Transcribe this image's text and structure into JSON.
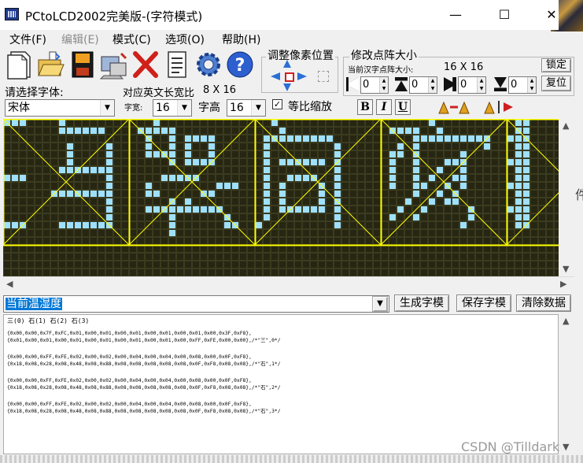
{
  "window": {
    "title": "PCtoLCD2002完美版-(字符模式)",
    "minimize": "—",
    "maximize": "☐",
    "close": "✕"
  },
  "menu": [
    {
      "label": "文件(F)",
      "enabled": true
    },
    {
      "label": "编辑(E)",
      "enabled": false
    },
    {
      "label": "模式(C)",
      "enabled": true
    },
    {
      "label": "选项(O)",
      "enabled": true
    },
    {
      "label": "帮助(H)",
      "enabled": true
    }
  ],
  "toolbar": {
    "icons": [
      "new-file-icon",
      "open-file-icon",
      "save-icon",
      "export-icon",
      "delete-icon",
      "notes-icon",
      "settings-gear-icon",
      "help-icon"
    ]
  },
  "font_panel": {
    "select_font_label": "请选择字体:",
    "font_value": "宋体",
    "ratio_label": "对应英文长宽比",
    "ratio_value": "8 X 16",
    "width_label": "字宽:",
    "width_value": "16",
    "height_label": "字高",
    "height_value": "16",
    "proportional_label": "等比缩放",
    "proportional_checked": true,
    "bold_label": "B",
    "italic_label": "I",
    "underline_label": "U"
  },
  "pixel_adjust": {
    "title": "调整像素位置"
  },
  "matrix_size": {
    "title": "修改点阵大小",
    "current_label": "当前汉字点阵大小:",
    "current_value": "16 X 16",
    "lock_label": "锁定",
    "reset_label": "复位",
    "spins": [
      "0",
      "0",
      "0",
      "0"
    ]
  },
  "grid": {
    "cols": 16,
    "rows": 16,
    "on_color": "#9fe0ff",
    "off_color": "#262613",
    "line_color": "#6a6a3c",
    "border_color": "#ffff00",
    "chars": [
      [
        "1110000100000000",
        "0000000111111000",
        "0000000000000000",
        "0000000010000100",
        "0000000010000100",
        "0000000010000100",
        "0000000111111100",
        "1110000000000100",
        "0000000000000100",
        "0000001111111100",
        "0000000000000100",
        "0000000000000100",
        "0000000000000100",
        "1110000111111100",
        "0000000000000000",
        "0000000000000000"
      ],
      [
        "0001000000000000",
        "0111110000000000",
        "0010010111100000",
        "0010010100100000",
        "0011110100100000",
        "0000010111100000",
        "0000000000000000",
        "0000111110000000",
        "0010000000011100",
        "0011000001100000",
        "0000010100000000",
        "0011111111110000",
        "0000010000001000",
        "0000010000001100",
        "0000010000000000",
        "0000000000000000"
      ],
      [
        "0010000000000000",
        "0001000000000000",
        "0111111111000000",
        "0100000000100000",
        "0100000000100000",
        "0101111110100000",
        "0100000000100000",
        "0100111100100000",
        "0101000010100000",
        "0101000010100000",
        "0101000010100000",
        "0101111110100000",
        "0100000000100000",
        "1000000000100000",
        "0000000000000000",
        "0000000000000000"
      ],
      [
        "0000001000000000",
        "0111100100000000",
        "0000111111111100",
        "0010100000000100",
        "0110100000100000",
        "0100100011100000",
        "0100100100100000",
        "0100101001100000",
        "0100110010100000",
        "0000100101000000",
        "0001001011000000",
        "0010010000010000",
        "0100100000010000",
        "0000000000100000",
        "0000000000000000",
        "0000000000000000"
      ],
      [
        "0110000000000000",
        "0110000000000000",
        "1110000000000000",
        "0110000000000000",
        "0110000000000000",
        "1110000000000000",
        "0110000000000000",
        "0110000000000000",
        "1110000000000000",
        "0110000000000000",
        "0110000000000000",
        "1110000000000000",
        "0110000000000000",
        "0110000000000000",
        "0000000000000000",
        "0000000000000000"
      ]
    ]
  },
  "bottom": {
    "input_text": "当前温湿度",
    "generate_label": "生成字模",
    "save_label": "保存字模",
    "clear_label": "清除数据",
    "output_header": "三(0)  石(1)  石(2)  石(3)",
    "output_lines": [
      "{0x00,0x00,0x7F,0xFC,0x01,0x00,0x01,0x00,0x01,0x00,0x01,0x00,0x01,0x00,0x3F,0xF8},",
      "{0x01,0x00,0x01,0x00,0x01,0x00,0x01,0x00,0x01,0x00,0x01,0x00,0xFF,0xFE,0x00,0x00},/*\"三\",0*/",
      "",
      "{0x00,0x00,0xFF,0xFE,0x02,0x00,0x02,0x00,0x04,0x00,0x04,0x00,0x08,0x00,0x0F,0xF8},",
      "{0x18,0x08,0x28,0x08,0x48,0x08,0x88,0x08,0x08,0x08,0x08,0x08,0x0F,0xF8,0x08,0x08},/*\"石\",1*/",
      "",
      "{0x00,0x00,0xFF,0xFE,0x02,0x00,0x02,0x00,0x04,0x00,0x04,0x00,0x08,0x00,0x0F,0xF8},",
      "{0x18,0x08,0x28,0x08,0x48,0x08,0x88,0x08,0x08,0x08,0x08,0x08,0x0F,0xF8,0x08,0x08},/*\"石\",2*/",
      "",
      "{0x00,0x00,0xFF,0xFE,0x02,0x00,0x02,0x00,0x04,0x00,0x04,0x00,0x08,0x00,0x0F,0xF8},",
      "{0x18,0x08,0x28,0x08,0x48,0x08,0x88,0x08,0x08,0x08,0x08,0x08,0x0F,0xF8,0x08,0x08},/*\"石\",3*/"
    ]
  },
  "side_glyph": "件",
  "watermark": "CSDN @Tilldark"
}
